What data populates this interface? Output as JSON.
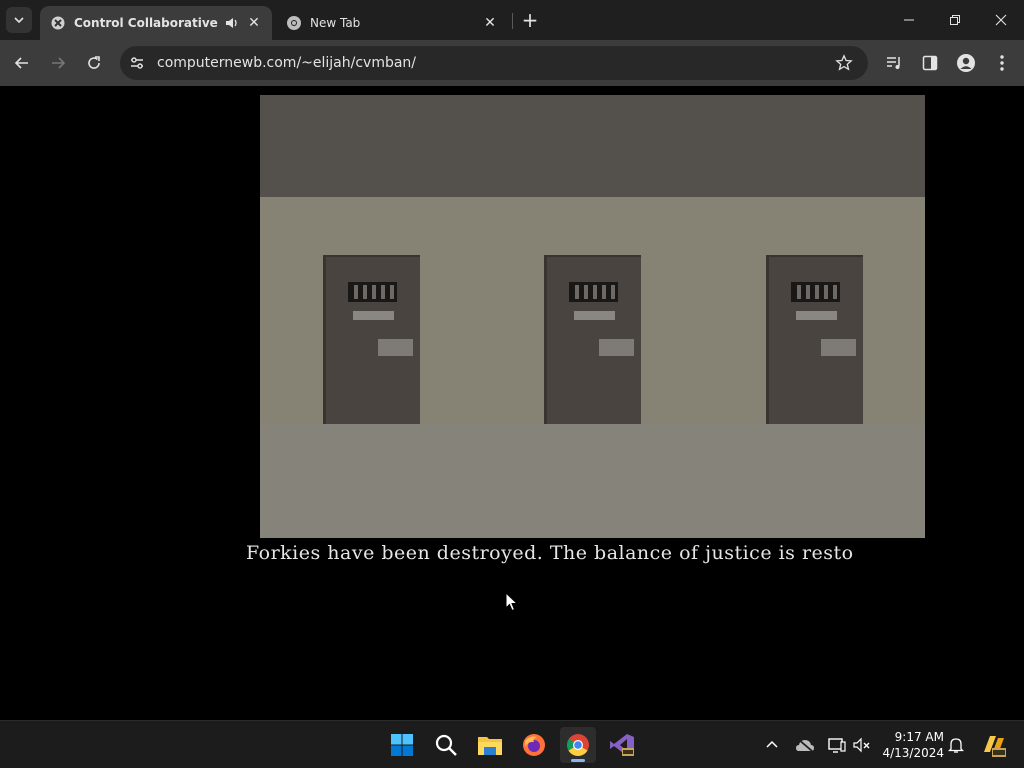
{
  "browser": {
    "tabs": [
      {
        "title": "Control Collaborative Virtu",
        "active": true,
        "audio": true
      },
      {
        "title": "New Tab",
        "active": false
      }
    ],
    "url": "computernewb.com/~elijah/cvmban/"
  },
  "game": {
    "subtitle": "Forkies have been destroyed. The balance of justice is resto"
  },
  "taskbar": {
    "apps": [
      "windows-start",
      "search",
      "file-explorer",
      "firefox",
      "chrome",
      "visual-studio-preview"
    ],
    "active_app": "chrome",
    "clock_time": "9:17 AM",
    "clock_date": "4/13/2024"
  },
  "colors": {
    "tab_bar": "#1f1f1f",
    "toolbar": "#3c3c3c",
    "omnibox": "#282828",
    "ceiling": "#54504b",
    "wall": "#868274",
    "floor": "#86837a",
    "door": "#4a4440"
  }
}
